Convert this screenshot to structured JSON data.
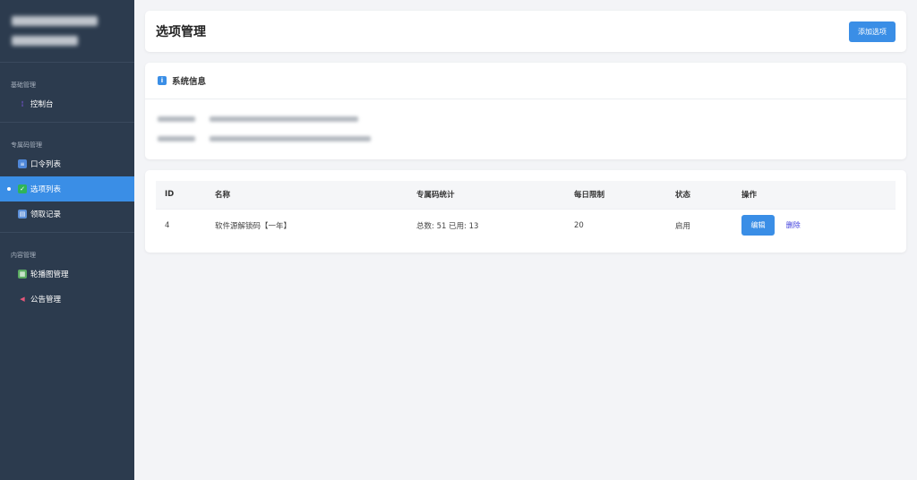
{
  "sidebar": {
    "sections": [
      {
        "title": "基础管理",
        "items": [
          {
            "label": "控制台",
            "icon": "console-icon",
            "active": false
          }
        ]
      },
      {
        "title": "专属码管理",
        "items": [
          {
            "label": "口令列表",
            "icon": "list-icon",
            "active": false
          },
          {
            "label": "选项列表",
            "icon": "check-icon",
            "active": true
          },
          {
            "label": "领取记录",
            "icon": "record-icon",
            "active": false
          }
        ]
      },
      {
        "title": "内容管理",
        "items": [
          {
            "label": "轮播图管理",
            "icon": "image-icon",
            "active": false
          },
          {
            "label": "公告管理",
            "icon": "megaphone-icon",
            "active": false
          }
        ]
      }
    ]
  },
  "header": {
    "title": "选项管理",
    "add_button": "添加选项"
  },
  "info": {
    "title": "系统信息"
  },
  "table": {
    "columns": [
      "ID",
      "名称",
      "专属码统计",
      "每日限制",
      "状态",
      "操作"
    ],
    "rows": [
      {
        "id": "4",
        "name": "软件源解锁码【一年】",
        "stats": "总数: 51 已用: 13",
        "daily_limit": "20",
        "status": "启用",
        "edit": "编辑",
        "delete": "删除"
      }
    ]
  },
  "colors": {
    "sidebar_bg": "#2c3b4e",
    "accent": "#3a8ee6",
    "delete_link": "#3b3bdc"
  }
}
